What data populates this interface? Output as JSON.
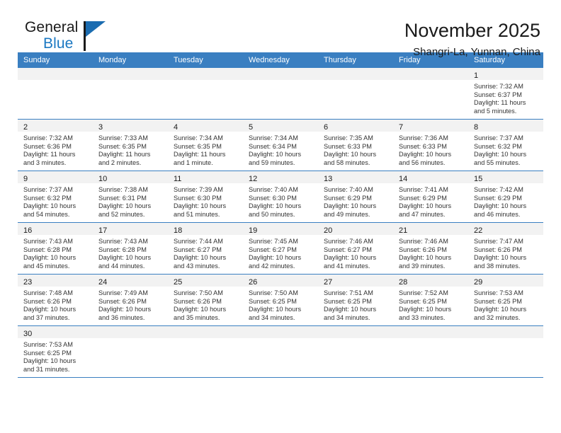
{
  "brand": {
    "name_top": "General",
    "name_bottom": "Blue",
    "accent_color": "#1b78c2",
    "triangle_color": "#1b6cb0"
  },
  "header": {
    "title": "November 2025",
    "subtitle": "Shangri-La, Yunnan, China"
  },
  "theme": {
    "header_bar_color": "#3a7fc1",
    "daynum_band_color": "#f2f2f2",
    "grid_line_color": "#3a7fc1",
    "text_color": "#333333"
  },
  "calendar": {
    "weekday_headers": [
      "Sunday",
      "Monday",
      "Tuesday",
      "Wednesday",
      "Thursday",
      "Friday",
      "Saturday"
    ],
    "weeks": [
      [
        {
          "day": "",
          "sunrise": "",
          "sunset": "",
          "daylight_1": "",
          "daylight_2": ""
        },
        {
          "day": "",
          "sunrise": "",
          "sunset": "",
          "daylight_1": "",
          "daylight_2": ""
        },
        {
          "day": "",
          "sunrise": "",
          "sunset": "",
          "daylight_1": "",
          "daylight_2": ""
        },
        {
          "day": "",
          "sunrise": "",
          "sunset": "",
          "daylight_1": "",
          "daylight_2": ""
        },
        {
          "day": "",
          "sunrise": "",
          "sunset": "",
          "daylight_1": "",
          "daylight_2": ""
        },
        {
          "day": "",
          "sunrise": "",
          "sunset": "",
          "daylight_1": "",
          "daylight_2": ""
        },
        {
          "day": "1",
          "sunrise": "Sunrise: 7:32 AM",
          "sunset": "Sunset: 6:37 PM",
          "daylight_1": "Daylight: 11 hours",
          "daylight_2": "and 5 minutes."
        }
      ],
      [
        {
          "day": "2",
          "sunrise": "Sunrise: 7:32 AM",
          "sunset": "Sunset: 6:36 PM",
          "daylight_1": "Daylight: 11 hours",
          "daylight_2": "and 3 minutes."
        },
        {
          "day": "3",
          "sunrise": "Sunrise: 7:33 AM",
          "sunset": "Sunset: 6:35 PM",
          "daylight_1": "Daylight: 11 hours",
          "daylight_2": "and 2 minutes."
        },
        {
          "day": "4",
          "sunrise": "Sunrise: 7:34 AM",
          "sunset": "Sunset: 6:35 PM",
          "daylight_1": "Daylight: 11 hours",
          "daylight_2": "and 1 minute."
        },
        {
          "day": "5",
          "sunrise": "Sunrise: 7:34 AM",
          "sunset": "Sunset: 6:34 PM",
          "daylight_1": "Daylight: 10 hours",
          "daylight_2": "and 59 minutes."
        },
        {
          "day": "6",
          "sunrise": "Sunrise: 7:35 AM",
          "sunset": "Sunset: 6:33 PM",
          "daylight_1": "Daylight: 10 hours",
          "daylight_2": "and 58 minutes."
        },
        {
          "day": "7",
          "sunrise": "Sunrise: 7:36 AM",
          "sunset": "Sunset: 6:33 PM",
          "daylight_1": "Daylight: 10 hours",
          "daylight_2": "and 56 minutes."
        },
        {
          "day": "8",
          "sunrise": "Sunrise: 7:37 AM",
          "sunset": "Sunset: 6:32 PM",
          "daylight_1": "Daylight: 10 hours",
          "daylight_2": "and 55 minutes."
        }
      ],
      [
        {
          "day": "9",
          "sunrise": "Sunrise: 7:37 AM",
          "sunset": "Sunset: 6:32 PM",
          "daylight_1": "Daylight: 10 hours",
          "daylight_2": "and 54 minutes."
        },
        {
          "day": "10",
          "sunrise": "Sunrise: 7:38 AM",
          "sunset": "Sunset: 6:31 PM",
          "daylight_1": "Daylight: 10 hours",
          "daylight_2": "and 52 minutes."
        },
        {
          "day": "11",
          "sunrise": "Sunrise: 7:39 AM",
          "sunset": "Sunset: 6:30 PM",
          "daylight_1": "Daylight: 10 hours",
          "daylight_2": "and 51 minutes."
        },
        {
          "day": "12",
          "sunrise": "Sunrise: 7:40 AM",
          "sunset": "Sunset: 6:30 PM",
          "daylight_1": "Daylight: 10 hours",
          "daylight_2": "and 50 minutes."
        },
        {
          "day": "13",
          "sunrise": "Sunrise: 7:40 AM",
          "sunset": "Sunset: 6:29 PM",
          "daylight_1": "Daylight: 10 hours",
          "daylight_2": "and 49 minutes."
        },
        {
          "day": "14",
          "sunrise": "Sunrise: 7:41 AM",
          "sunset": "Sunset: 6:29 PM",
          "daylight_1": "Daylight: 10 hours",
          "daylight_2": "and 47 minutes."
        },
        {
          "day": "15",
          "sunrise": "Sunrise: 7:42 AM",
          "sunset": "Sunset: 6:29 PM",
          "daylight_1": "Daylight: 10 hours",
          "daylight_2": "and 46 minutes."
        }
      ],
      [
        {
          "day": "16",
          "sunrise": "Sunrise: 7:43 AM",
          "sunset": "Sunset: 6:28 PM",
          "daylight_1": "Daylight: 10 hours",
          "daylight_2": "and 45 minutes."
        },
        {
          "day": "17",
          "sunrise": "Sunrise: 7:43 AM",
          "sunset": "Sunset: 6:28 PM",
          "daylight_1": "Daylight: 10 hours",
          "daylight_2": "and 44 minutes."
        },
        {
          "day": "18",
          "sunrise": "Sunrise: 7:44 AM",
          "sunset": "Sunset: 6:27 PM",
          "daylight_1": "Daylight: 10 hours",
          "daylight_2": "and 43 minutes."
        },
        {
          "day": "19",
          "sunrise": "Sunrise: 7:45 AM",
          "sunset": "Sunset: 6:27 PM",
          "daylight_1": "Daylight: 10 hours",
          "daylight_2": "and 42 minutes."
        },
        {
          "day": "20",
          "sunrise": "Sunrise: 7:46 AM",
          "sunset": "Sunset: 6:27 PM",
          "daylight_1": "Daylight: 10 hours",
          "daylight_2": "and 41 minutes."
        },
        {
          "day": "21",
          "sunrise": "Sunrise: 7:46 AM",
          "sunset": "Sunset: 6:26 PM",
          "daylight_1": "Daylight: 10 hours",
          "daylight_2": "and 39 minutes."
        },
        {
          "day": "22",
          "sunrise": "Sunrise: 7:47 AM",
          "sunset": "Sunset: 6:26 PM",
          "daylight_1": "Daylight: 10 hours",
          "daylight_2": "and 38 minutes."
        }
      ],
      [
        {
          "day": "23",
          "sunrise": "Sunrise: 7:48 AM",
          "sunset": "Sunset: 6:26 PM",
          "daylight_1": "Daylight: 10 hours",
          "daylight_2": "and 37 minutes."
        },
        {
          "day": "24",
          "sunrise": "Sunrise: 7:49 AM",
          "sunset": "Sunset: 6:26 PM",
          "daylight_1": "Daylight: 10 hours",
          "daylight_2": "and 36 minutes."
        },
        {
          "day": "25",
          "sunrise": "Sunrise: 7:50 AM",
          "sunset": "Sunset: 6:26 PM",
          "daylight_1": "Daylight: 10 hours",
          "daylight_2": "and 35 minutes."
        },
        {
          "day": "26",
          "sunrise": "Sunrise: 7:50 AM",
          "sunset": "Sunset: 6:25 PM",
          "daylight_1": "Daylight: 10 hours",
          "daylight_2": "and 34 minutes."
        },
        {
          "day": "27",
          "sunrise": "Sunrise: 7:51 AM",
          "sunset": "Sunset: 6:25 PM",
          "daylight_1": "Daylight: 10 hours",
          "daylight_2": "and 34 minutes."
        },
        {
          "day": "28",
          "sunrise": "Sunrise: 7:52 AM",
          "sunset": "Sunset: 6:25 PM",
          "daylight_1": "Daylight: 10 hours",
          "daylight_2": "and 33 minutes."
        },
        {
          "day": "29",
          "sunrise": "Sunrise: 7:53 AM",
          "sunset": "Sunset: 6:25 PM",
          "daylight_1": "Daylight: 10 hours",
          "daylight_2": "and 32 minutes."
        }
      ],
      [
        {
          "day": "30",
          "sunrise": "Sunrise: 7:53 AM",
          "sunset": "Sunset: 6:25 PM",
          "daylight_1": "Daylight: 10 hours",
          "daylight_2": "and 31 minutes."
        },
        {
          "day": "",
          "sunrise": "",
          "sunset": "",
          "daylight_1": "",
          "daylight_2": ""
        },
        {
          "day": "",
          "sunrise": "",
          "sunset": "",
          "daylight_1": "",
          "daylight_2": ""
        },
        {
          "day": "",
          "sunrise": "",
          "sunset": "",
          "daylight_1": "",
          "daylight_2": ""
        },
        {
          "day": "",
          "sunrise": "",
          "sunset": "",
          "daylight_1": "",
          "daylight_2": ""
        },
        {
          "day": "",
          "sunrise": "",
          "sunset": "",
          "daylight_1": "",
          "daylight_2": ""
        },
        {
          "day": "",
          "sunrise": "",
          "sunset": "",
          "daylight_1": "",
          "daylight_2": ""
        }
      ]
    ]
  }
}
